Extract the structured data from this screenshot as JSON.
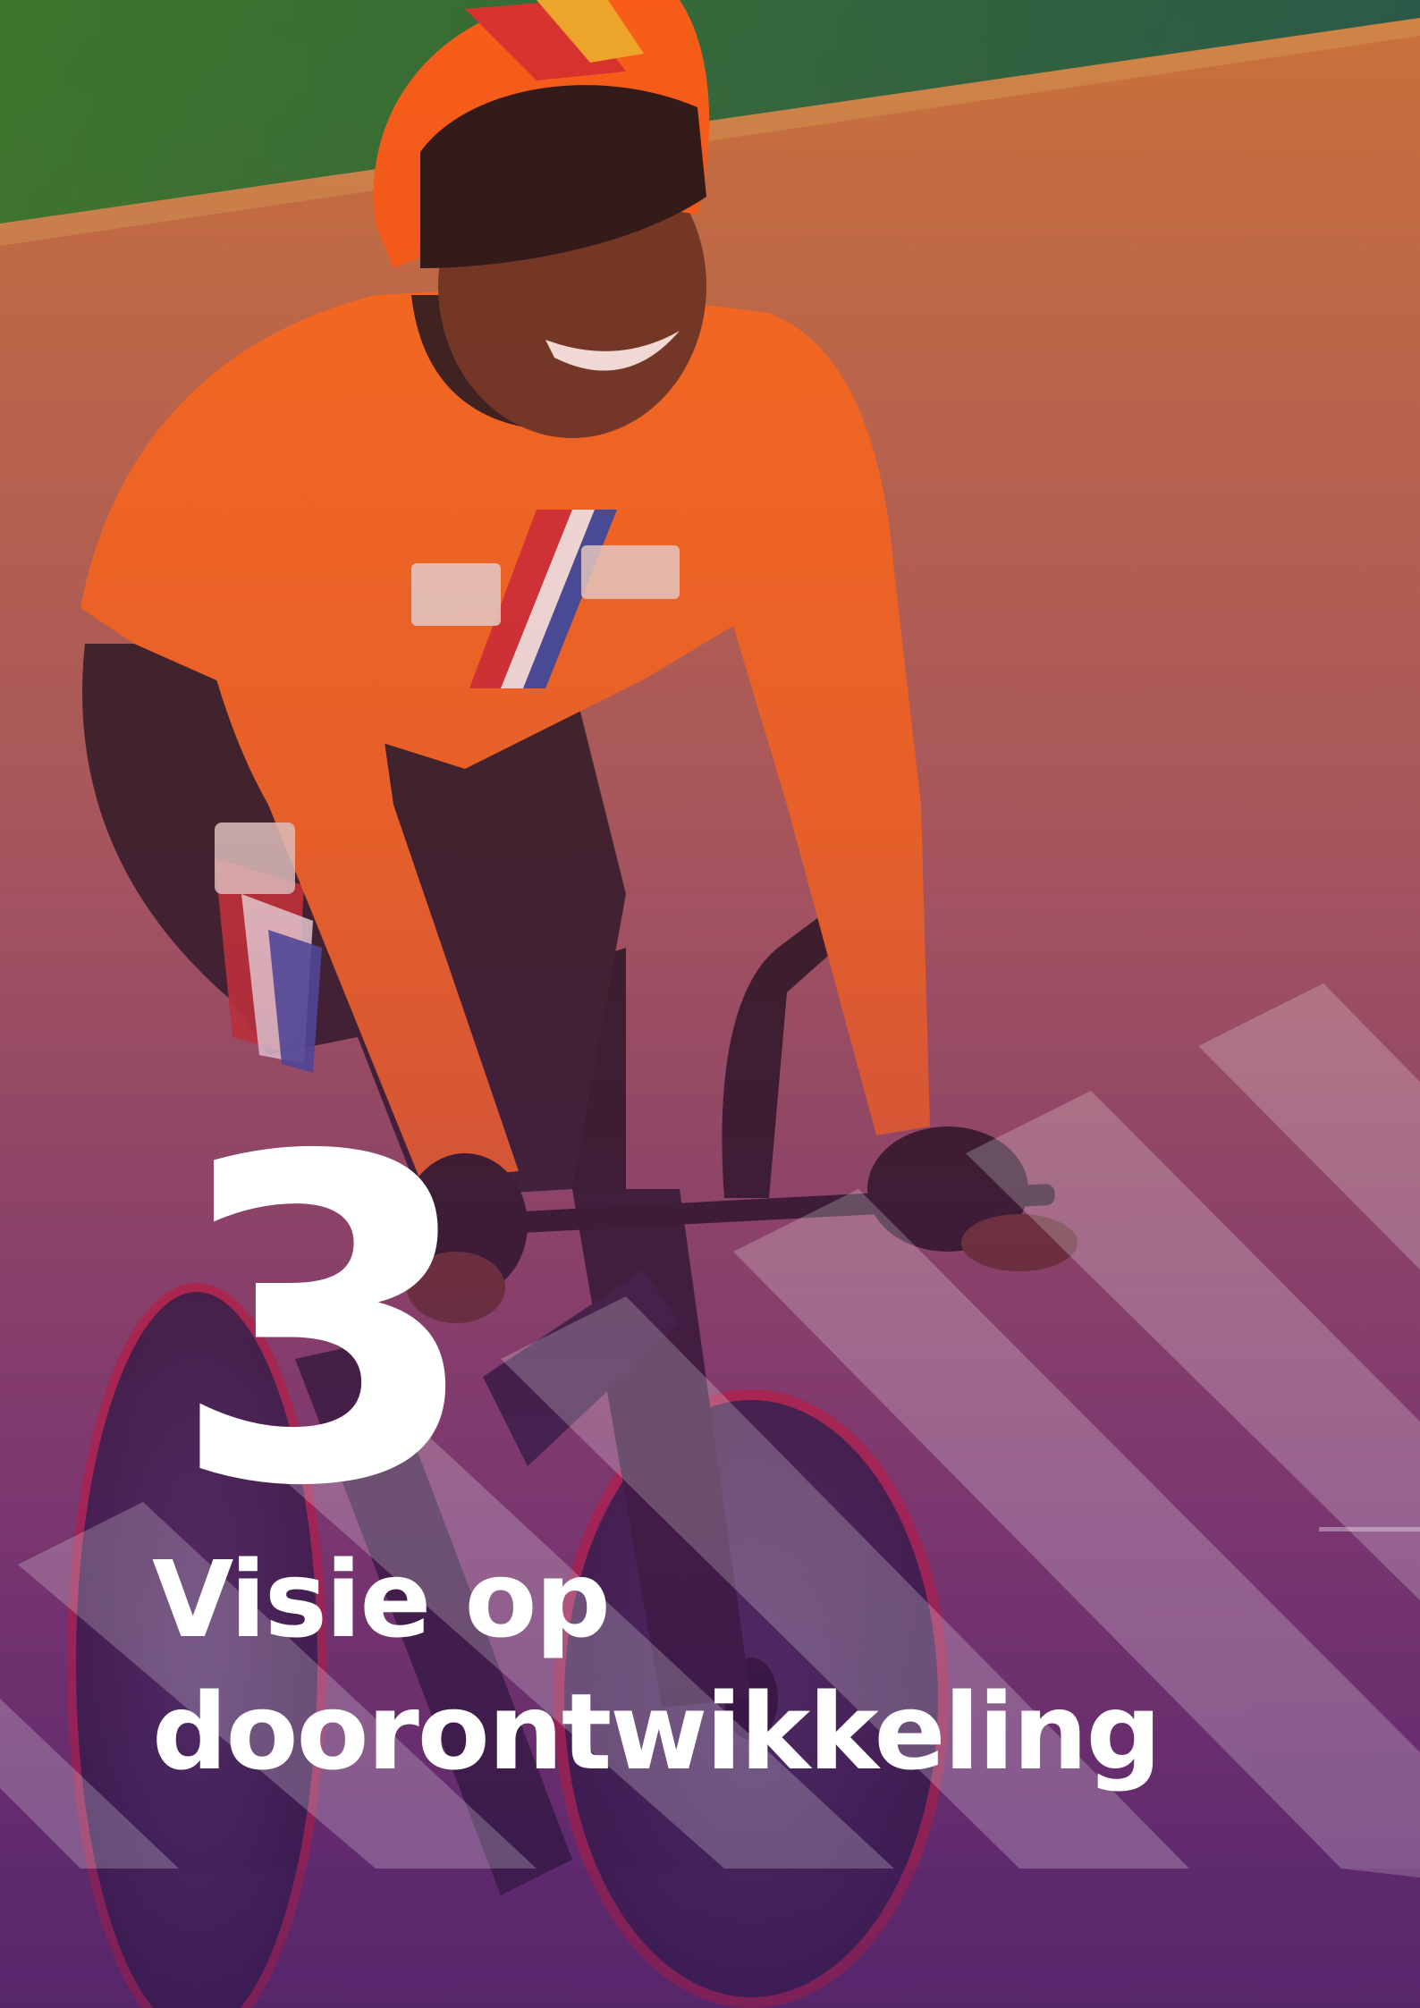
{
  "chapter": {
    "number": "3",
    "title_line1": "Visie op",
    "title_line2": "doorontwikkeling"
  },
  "colors": {
    "overlay_top": "#c86a3a",
    "overlay_bottom": "#5a2b66",
    "text": "#ffffff",
    "stripe": "#ffffff",
    "jersey": "#ff6a1a",
    "track_band": "#0d6a3c"
  },
  "photo": {
    "subject": "track cyclist in orange Dutch kit on time-trial bike"
  }
}
